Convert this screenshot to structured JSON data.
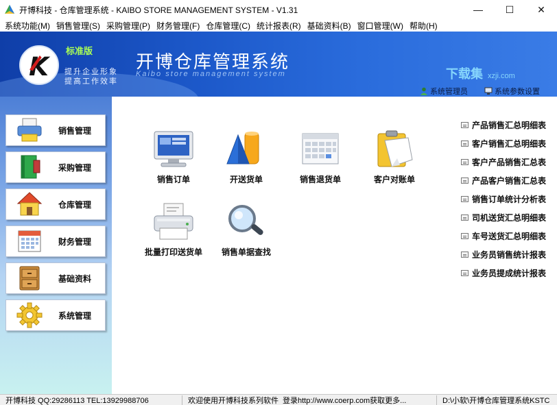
{
  "window": {
    "title": "开博科技 - 仓库管理系统 - KAIBO STORE MANAGEMENT SYSTEM - V1.31",
    "controls": {
      "minimize": "—",
      "maximize": "☐",
      "close": "✕"
    }
  },
  "menu": [
    "系统功能(M)",
    "销售管理(S)",
    "采购管理(P)",
    "财务管理(F)",
    "仓库管理(C)",
    "统计报表(R)",
    "基础资料(B)",
    "窗口管理(W)",
    "帮助(H)"
  ],
  "header": {
    "logo_letter": "K",
    "edition": "标准版",
    "slogan_line1": "提升企业形象",
    "slogan_line2": "提高工作效率",
    "system_title": "开博仓库管理系统",
    "system_subtitle": "Kaibo store management system",
    "link_admin": "系统管理员",
    "link_settings": "系统参数设置",
    "watermark_cn": "下载集",
    "watermark_en": "xzji.com"
  },
  "sidebar": [
    {
      "label": "销售管理",
      "icon": "printer-icon"
    },
    {
      "label": "采购管理",
      "icon": "book-icon"
    },
    {
      "label": "仓库管理",
      "icon": "house-icon"
    },
    {
      "label": "财务管理",
      "icon": "calendar-icon"
    },
    {
      "label": "基础资料",
      "icon": "cabinet-icon"
    },
    {
      "label": "系统管理",
      "icon": "gear-icon"
    }
  ],
  "tools": [
    {
      "label": "销售订单",
      "icon": "monitor-icon"
    },
    {
      "label": "开送货单",
      "icon": "shapes-icon"
    },
    {
      "label": "销售退货单",
      "icon": "calendar-icon"
    },
    {
      "label": "客户对账单",
      "icon": "clipboard-icon"
    },
    {
      "label": "批量打印送货单",
      "icon": "printer-icon"
    },
    {
      "label": "销售单据查找",
      "icon": "magnifier-icon"
    }
  ],
  "reports": [
    "产品销售汇总明细表",
    "客户销售汇总明细表",
    "客户产品销售汇总表",
    "产品客户销售汇总表",
    "销售订单统计分析表",
    "司机送货汇总明细表",
    "车号送货汇总明细表",
    "业务员销售统计报表",
    "业务员提成统计报表"
  ],
  "status": {
    "company": "开博科技 QQ:29286113 TEL:13929988706",
    "welcome": "欢迎使用开博科技系列软件",
    "login": "登录http://www.coerp.com获取更多...",
    "path": "D:\\小软\\开博仓库管理系统KSTC"
  },
  "colors": {
    "banner": "#1c58c9",
    "edition": "#aaff55",
    "logo_red": "#d21c1c"
  }
}
